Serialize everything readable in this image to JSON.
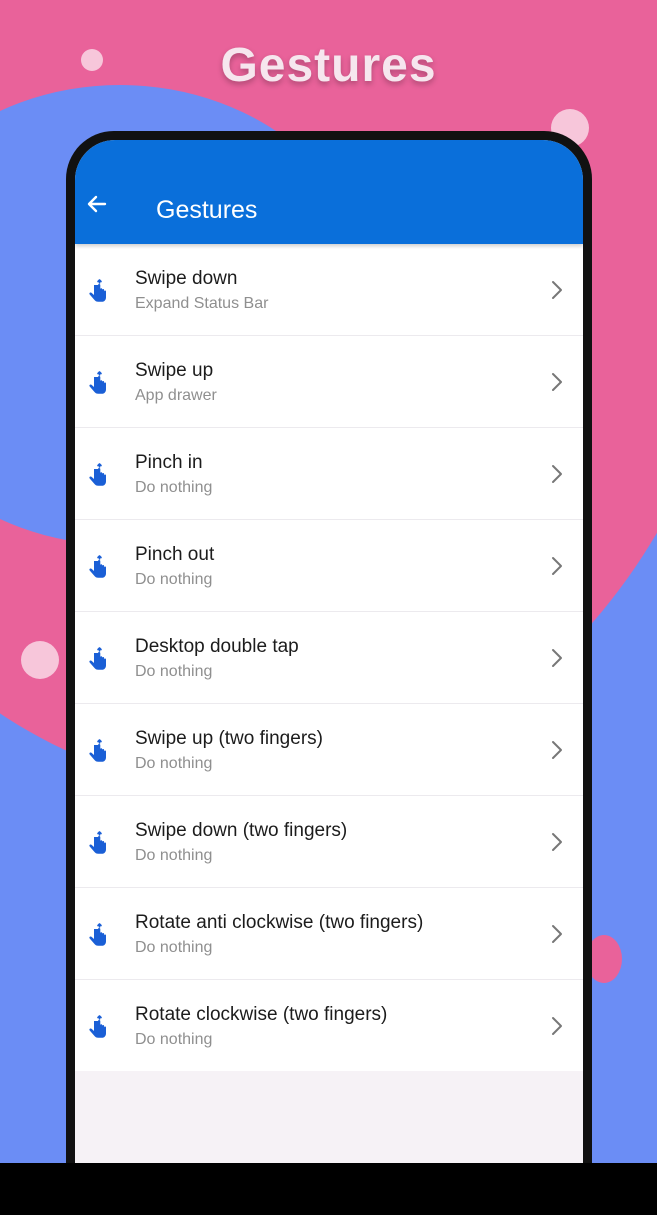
{
  "headline": "Gestures",
  "app_bar": {
    "title": "Gestures",
    "back_icon": "arrow-left-icon"
  },
  "colors": {
    "app_bar": "#0a6fda",
    "icon": "#1a5fd6",
    "background_pink": "#e9629a",
    "background_blue": "#6b8df5"
  },
  "gestures": [
    {
      "title": "Swipe down",
      "subtitle": "Expand Status Bar",
      "icon": "swipe-down-gesture-icon"
    },
    {
      "title": "Swipe up",
      "subtitle": "App drawer",
      "icon": "swipe-up-gesture-icon"
    },
    {
      "title": "Pinch in",
      "subtitle": "Do nothing",
      "icon": "pinch-in-gesture-icon"
    },
    {
      "title": "Pinch out",
      "subtitle": "Do nothing",
      "icon": "pinch-out-gesture-icon"
    },
    {
      "title": "Desktop double tap",
      "subtitle": "Do nothing",
      "icon": "double-tap-gesture-icon"
    },
    {
      "title": "Swipe up (two fingers)",
      "subtitle": "Do nothing",
      "icon": "two-finger-swipe-up-icon"
    },
    {
      "title": "Swipe down (two fingers)",
      "subtitle": "Do nothing",
      "icon": "two-finger-swipe-down-icon"
    },
    {
      "title": "Rotate anti clockwise (two fingers)",
      "subtitle": "Do nothing",
      "icon": "rotate-anticlockwise-gesture-icon"
    },
    {
      "title": "Rotate clockwise (two fingers)",
      "subtitle": "Do nothing",
      "icon": "rotate-clockwise-gesture-icon"
    }
  ]
}
